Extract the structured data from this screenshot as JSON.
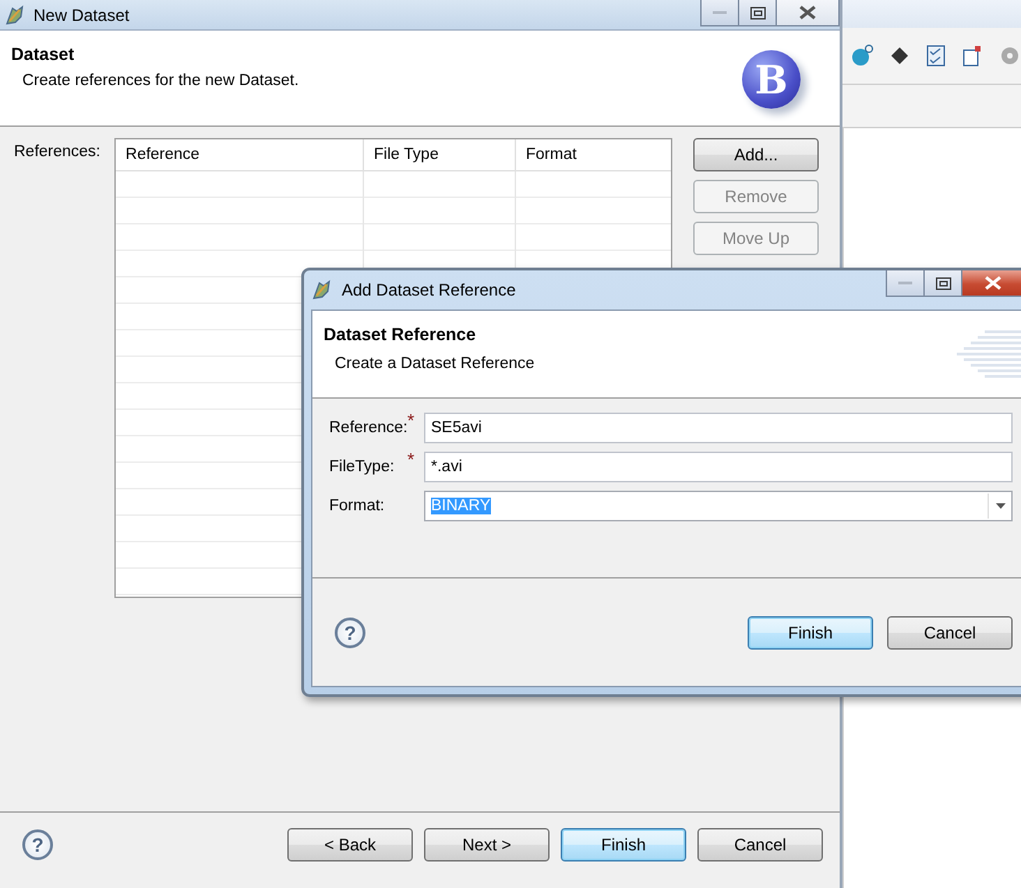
{
  "main_window": {
    "title": "New Dataset",
    "header": {
      "title": "Dataset",
      "description": "Create references for the new Dataset.",
      "logo_letter": "B"
    },
    "references_label": "References:",
    "table": {
      "columns": [
        "Reference",
        "File Type",
        "Format"
      ]
    },
    "side_buttons": [
      {
        "label": "Add...",
        "disabled": false
      },
      {
        "label": "Remove",
        "disabled": true
      },
      {
        "label": "Move Up",
        "disabled": true
      }
    ],
    "help": "?",
    "footer_buttons": [
      {
        "label": "< Back",
        "default": false
      },
      {
        "label": "Next >",
        "default": false
      },
      {
        "label": "Finish",
        "default": true
      },
      {
        "label": "Cancel",
        "default": false
      }
    ]
  },
  "dialog": {
    "title": "Add Dataset Reference",
    "header": {
      "title": "Dataset Reference",
      "description": "Create a Dataset Reference"
    },
    "required_marker": "*",
    "fields": [
      {
        "label": "Reference:",
        "required": true,
        "kind": "text",
        "value": "SE5avi",
        "highlighted": false
      },
      {
        "label": "FileType:",
        "required": true,
        "kind": "text",
        "value": "*.avi",
        "highlighted": false
      },
      {
        "label": "Format:",
        "required": false,
        "kind": "dropdown",
        "value": "BINARY",
        "highlighted": true
      }
    ],
    "help": "?",
    "buttons": [
      {
        "label": "Finish",
        "default": true
      },
      {
        "label": "Cancel",
        "default": false
      }
    ]
  }
}
